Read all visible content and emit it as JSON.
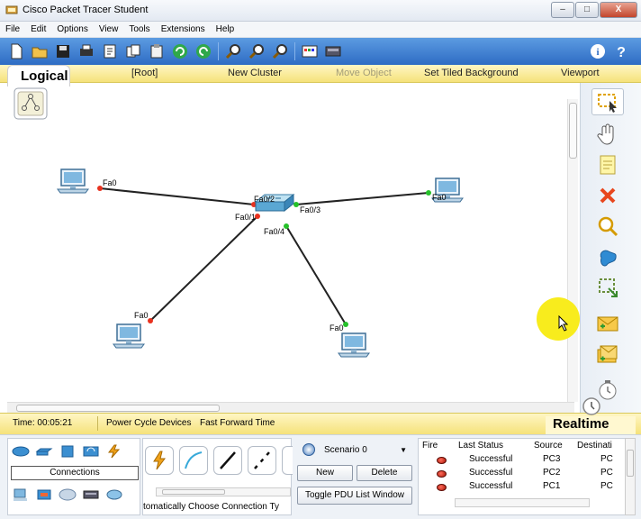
{
  "window": {
    "title": "Cisco Packet Tracer Student",
    "min": "–",
    "max": "□",
    "close": "X"
  },
  "menu": [
    "File",
    "Edit",
    "Options",
    "View",
    "Tools",
    "Extensions",
    "Help"
  ],
  "nav": {
    "logical": "Logical",
    "root": "[Root]",
    "new_cluster": "New Cluster",
    "move_object": "Move Object",
    "set_tiled_background": "Set Tiled Background",
    "viewport": "Viewport"
  },
  "topology": {
    "ports": {
      "pc_left_top": "Fa0",
      "pc_right_top": "Fa0",
      "pc_left_bottom": "Fa0",
      "pc_right_bottom": "Fa0",
      "switch_fa02": "Fa0/2",
      "switch_fa01": "Fa0/1",
      "switch_fa03": "Fa0/3",
      "switch_fa04": "Fa0/4"
    }
  },
  "status": {
    "time": "Time: 00:05:21",
    "power_cycle": "Power Cycle Devices",
    "fast_forward": "Fast Forward Time",
    "realtime": "Realtime"
  },
  "devices": {
    "connections_label": "Connections",
    "hint": "tomatically Choose Connection Ty"
  },
  "scenario": {
    "selected": "Scenario 0",
    "new": "New",
    "delete": "Delete",
    "toggle": "Toggle PDU List Window"
  },
  "pdu_table": {
    "headers": [
      "Fire",
      "Last Status",
      "Source",
      "Destinati"
    ],
    "rows": [
      {
        "status": "Successful",
        "source": "PC3",
        "dest": "PC"
      },
      {
        "status": "Successful",
        "source": "PC2",
        "dest": "PC"
      },
      {
        "status": "Successful",
        "source": "PC1",
        "dest": "PC"
      }
    ]
  },
  "colors": {
    "toolbar": "#3d7fd6",
    "nav": "#f9eb9a",
    "link_green": "#26c12a",
    "link_red": "#e8321f",
    "cursor_highlight": "#f8ec1d"
  }
}
